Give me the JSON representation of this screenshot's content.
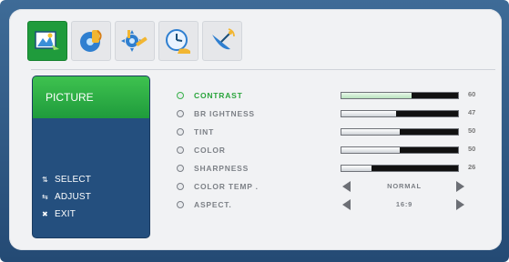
{
  "colors": {
    "accent": "#1f9b3c",
    "frame": "#2f5b86",
    "panel": "#244f7e",
    "bar_bg": "#111111",
    "label": "#7d8187"
  },
  "icons": [
    {
      "name": "picture-icon",
      "active": true
    },
    {
      "name": "sound-icon",
      "active": false
    },
    {
      "name": "setup-icon",
      "active": false
    },
    {
      "name": "time-icon",
      "active": false
    },
    {
      "name": "channel-icon",
      "active": false
    }
  ],
  "panel": {
    "title": "PICTURE",
    "help": [
      {
        "icon": "updown-arrows-icon",
        "text": "SELECT"
      },
      {
        "icon": "leftright-arrows-icon",
        "text": "ADJUST"
      },
      {
        "icon": "exit-icon",
        "text": "EXIT"
      }
    ]
  },
  "menu": [
    {
      "label": "CONTRAST",
      "value": 60,
      "selected": true
    },
    {
      "label": "BR IGHTNESS",
      "value": 47,
      "selected": false
    },
    {
      "label": "TINT",
      "value": 50,
      "selected": false
    },
    {
      "label": "COLOR",
      "value": 50,
      "selected": false
    },
    {
      "label": "SHARPNESS",
      "value": 26,
      "selected": false
    },
    {
      "label": "COLOR TEMP .",
      "option": "NORMAL",
      "selected": false
    },
    {
      "label": "ASPECT.",
      "option": "16:9",
      "selected": false
    }
  ],
  "display_values": [
    "60",
    "47",
    "50",
    "50",
    "26"
  ]
}
